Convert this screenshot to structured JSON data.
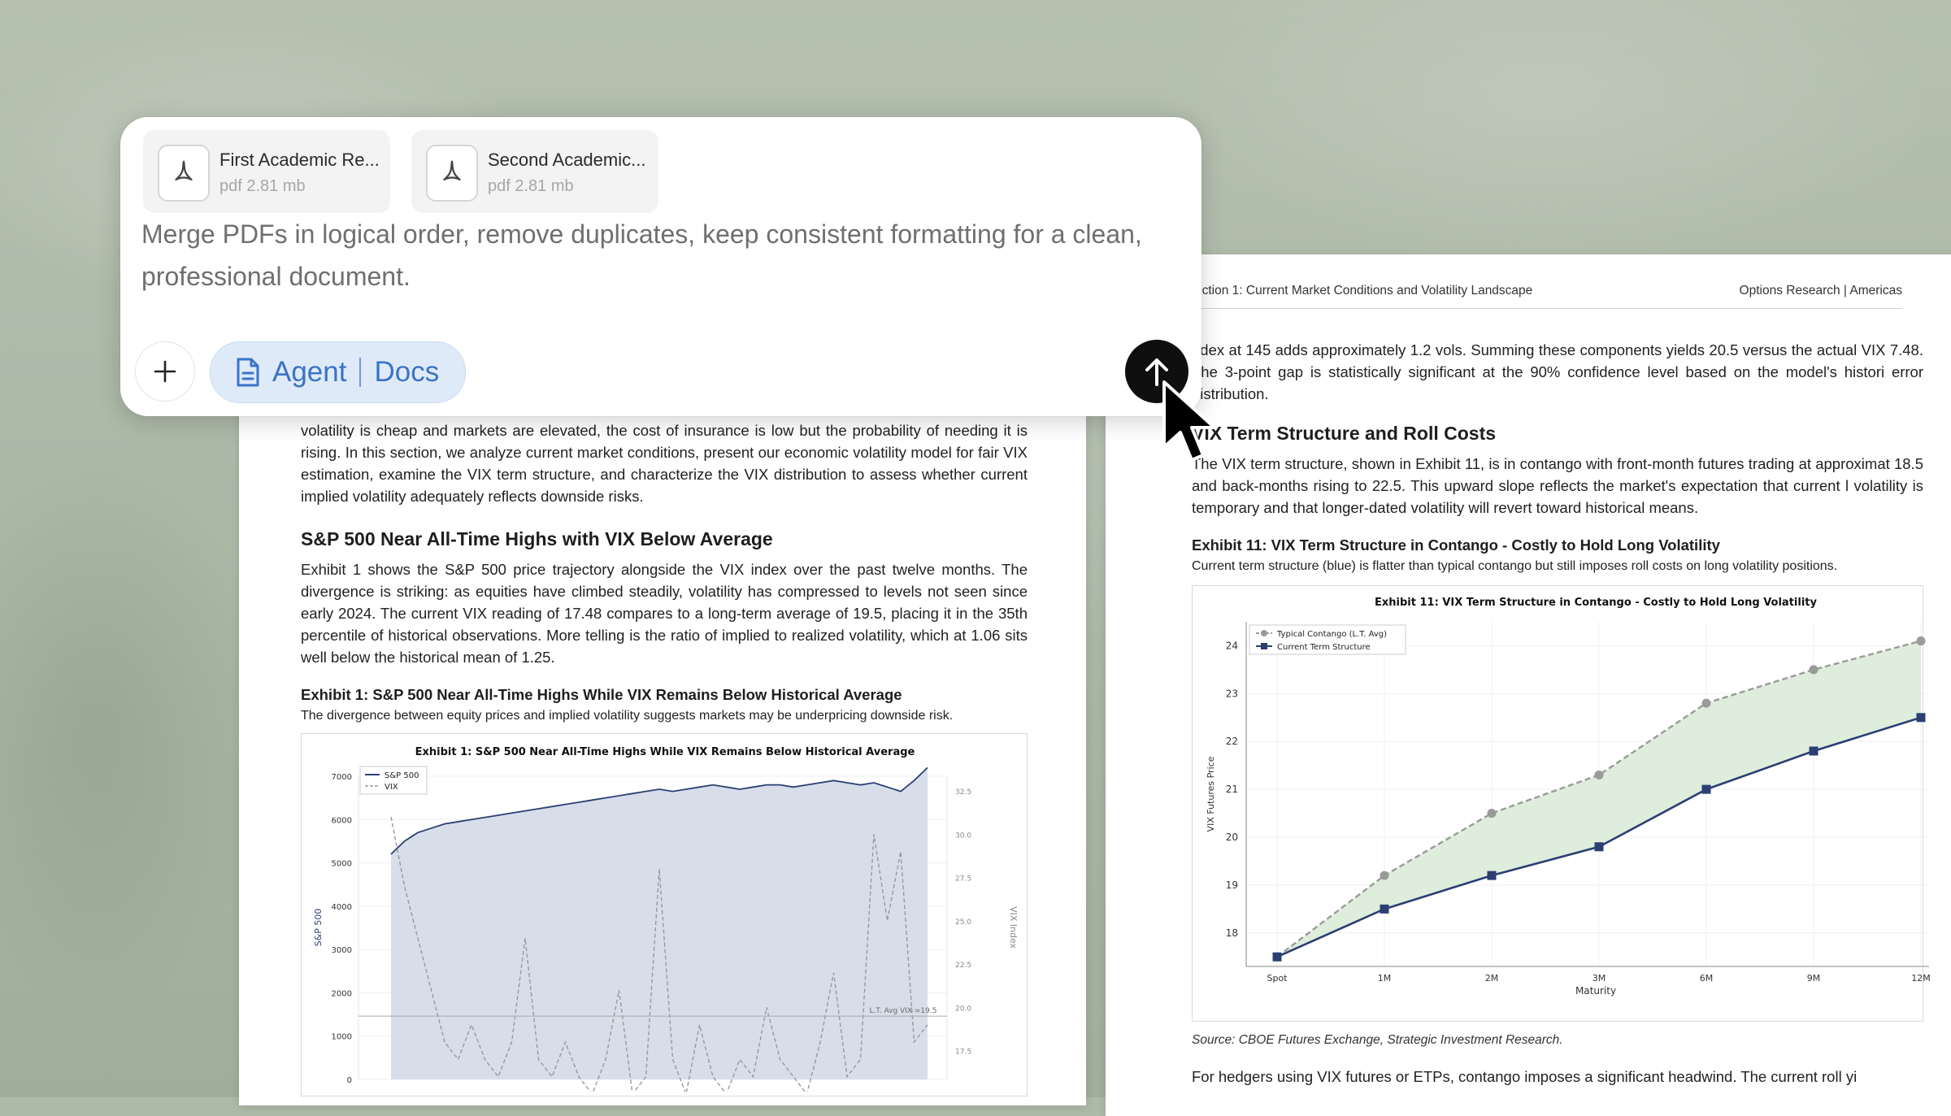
{
  "panel": {
    "attachments": [
      {
        "name": "First Academic Re...",
        "meta": "pdf 2.81 mb",
        "icon": "pdf-icon"
      },
      {
        "name": "Second Academic...",
        "meta": "pdf 2.81 mb",
        "icon": "pdf-icon"
      }
    ],
    "prompt": "Merge PDFs in logical order, remove duplicates, keep consistent formatting for a clean, professional document.",
    "add_icon": "plus-icon",
    "agent_chip": {
      "label_a": "Agent",
      "label_b": "Docs",
      "icon": "document-icon"
    },
    "send_icon": "arrow-up-icon",
    "colors": {
      "chip_bg": "#dfeaf8",
      "chip_text": "#3a74c6",
      "send_bg": "#0f0f0f"
    }
  },
  "left_page": {
    "intro": "volatility is cheap and markets are elevated, the cost of insurance is low but the probability of needing it is rising. In this section, we analyze current market conditions, present our economic volatility model for fair VIX estimation, examine the VIX term structure, and characterize the VIX distribution to assess whether current implied volatility adequately reflects downside risks.",
    "heading": "S&P 500 Near All-Time Highs with VIX Below Average",
    "body": "Exhibit 1 shows the S&P 500 price trajectory alongside the VIX index over the past twelve months. The divergence is striking: as equities have climbed steadily, volatility has compressed to levels not seen since early 2024. The current VIX reading of 17.48 compares to a long-term average of 19.5, placing it in the 35th percentile of historical observations. More telling is the ratio of implied to realized volatility, which at 1.06 sits well below the historical mean of 1.25.",
    "exhibit_title": "Exhibit 1: S&P 500 Near All-Time Highs While VIX Remains Below Historical Average",
    "exhibit_sub": "The divergence between equity prices and implied volatility suggests markets may be underpricing downside risk.",
    "chart_data": {
      "type": "line",
      "title": "Exhibit 1: S&P 500 Near All-Time Highs While VIX Remains Below Historical Average",
      "ylabel": "S&P 500",
      "y2label": "VIX Index",
      "ylim": [
        0,
        7000
      ],
      "y2lim": [
        15.0,
        32.5
      ],
      "yticks": [
        "0",
        "1000",
        "2000",
        "3000",
        "4000",
        "5000",
        "6000",
        "7000"
      ],
      "y2ticks": [
        "15.0",
        "17.5",
        "20.0",
        "22.5",
        "25.0",
        "27.5",
        "30.0",
        "32.5"
      ],
      "legend": [
        "S&P 500",
        "VIX"
      ],
      "legend_position": "top-left",
      "annotation": "L.T. Avg VIX =19.5",
      "reference_line": 19.5,
      "series": [
        {
          "name": "S&P 500",
          "values": [
            5200,
            5500,
            5700,
            5800,
            5900,
            5950,
            6000,
            6050,
            6100,
            6150,
            6200,
            6250,
            6300,
            6350,
            6400,
            6450,
            6500,
            6550,
            6600,
            6650,
            6700,
            6650,
            6700,
            6750,
            6800,
            6750,
            6700,
            6750,
            6800,
            6800,
            6750,
            6800,
            6850,
            6900,
            6850,
            6800,
            6850,
            6750,
            6650,
            6900,
            7200
          ]
        },
        {
          "name": "VIX",
          "values": [
            31,
            27,
            24,
            21,
            18,
            17,
            19,
            17,
            16,
            18,
            24,
            17,
            16,
            18,
            16,
            15,
            17,
            21,
            15,
            16,
            28,
            17,
            15,
            19,
            16,
            15,
            17,
            16,
            20,
            17,
            16,
            15,
            18,
            22,
            16,
            17,
            30,
            25,
            29,
            18,
            19
          ]
        }
      ]
    }
  },
  "right_page": {
    "header_left": "ection 1: Current Market Conditions and Volatility Landscape",
    "header_right": "Options Research | Americas",
    "intro": "ndex at 145 adds approximately 1.2 vols. Summing these components yields 20.5 versus the actual VIX 7.48. The 3-point gap is statistically significant at the 90% confidence level based on the model's histori error distribution.",
    "heading": "VIX Term Structure and Roll Costs",
    "body": "The VIX term structure, shown in Exhibit 11, is in contango with front-month futures trading at approximat 18.5 and back-months rising to 22.5. This upward slope reflects the market's expectation that current l volatility is temporary and that longer-dated volatility will revert toward historical means.",
    "exhibit_title": "Exhibit 11: VIX Term Structure in Contango - Costly to Hold Long Volatility",
    "exhibit_sub": "Current term structure (blue) is flatter than typical contango but still imposes roll costs on long volatility positions.",
    "source": "Source: CBOE Futures Exchange, Strategic Investment Research.",
    "footer_text": "For hedgers using VIX futures or ETPs, contango imposes a significant headwind. The current roll yi",
    "chart_data": {
      "type": "line",
      "title": "Exhibit 11: VIX Term Structure in Contango - Costly to Hold Long Volatility",
      "xlabel": "Maturity",
      "ylabel": "VIX Futures Price",
      "categories": [
        "Spot",
        "1M",
        "2M",
        "3M",
        "6M",
        "9M",
        "12M"
      ],
      "ylim": [
        17.3,
        24.5
      ],
      "yticks": [
        18,
        19,
        20,
        21,
        22,
        23,
        24
      ],
      "legend_position": "top-left",
      "series": [
        {
          "name": "Typical Contango (L.T. Avg)",
          "values": [
            17.5,
            19.2,
            20.5,
            21.3,
            22.8,
            23.5,
            24.1
          ],
          "color": "#9a9a9a"
        },
        {
          "name": "Current Term Structure",
          "values": [
            17.5,
            18.5,
            19.2,
            19.8,
            21.0,
            21.8,
            22.5
          ],
          "color": "#2b3f73"
        }
      ],
      "fill_color": "#d9ead6"
    }
  }
}
